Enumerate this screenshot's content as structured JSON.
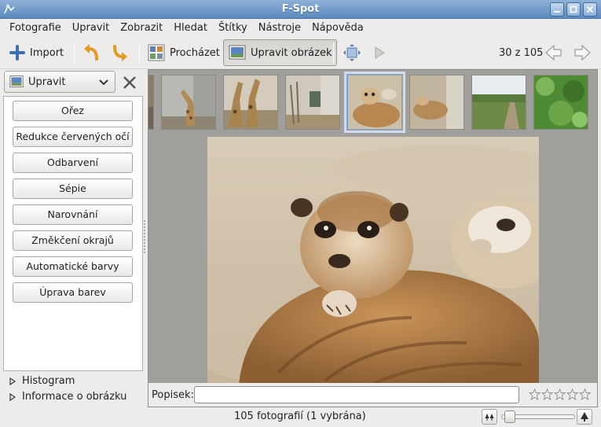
{
  "window": {
    "title": "F-Spot"
  },
  "menu": [
    {
      "label": "Fotografie"
    },
    {
      "label": "Upravit"
    },
    {
      "label": "Zobrazit"
    },
    {
      "label": "Hledat"
    },
    {
      "label": "Štítky"
    },
    {
      "label": "Nástroje"
    },
    {
      "label": "Nápověda"
    }
  ],
  "toolbar": {
    "import_label": "Import",
    "browse_label": "Procházet",
    "edit_label": "Upravit obrázek",
    "counter": "30 z 105",
    "icons": {
      "import": "plus-icon",
      "rotate_left": "rotate-left-icon",
      "rotate_right": "rotate-right-icon",
      "browse": "browse-grid-icon",
      "edit": "edit-image-icon",
      "fullscreen": "fullscreen-icon",
      "slideshow": "play-icon",
      "prev": "back-arrow-icon",
      "next": "forward-arrow-icon"
    }
  },
  "sidebar": {
    "mode_label": "Upravit",
    "buttons": [
      {
        "label": "Ořez"
      },
      {
        "label": "Redukce červených očí"
      },
      {
        "label": "Odbarvení"
      },
      {
        "label": "Sépie"
      },
      {
        "label": "Narovnání"
      },
      {
        "label": "Změkčení okrajů"
      },
      {
        "label": "Automatické barvy"
      },
      {
        "label": "Úprava barev"
      }
    ],
    "expanders": [
      {
        "label": "Histogram"
      },
      {
        "label": "Informace o obrázku"
      }
    ]
  },
  "caption": {
    "label": "Popisek:",
    "value": ""
  },
  "rating": {
    "stars": 0,
    "max": 5
  },
  "status": {
    "text": "105 fotografií (1 vybrána)"
  },
  "zoom": {
    "level": 0.05
  },
  "filmstrip": {
    "selected_index": 3
  },
  "colors": {
    "accent": "#5b89bd",
    "selection": "#7fa2cc"
  }
}
